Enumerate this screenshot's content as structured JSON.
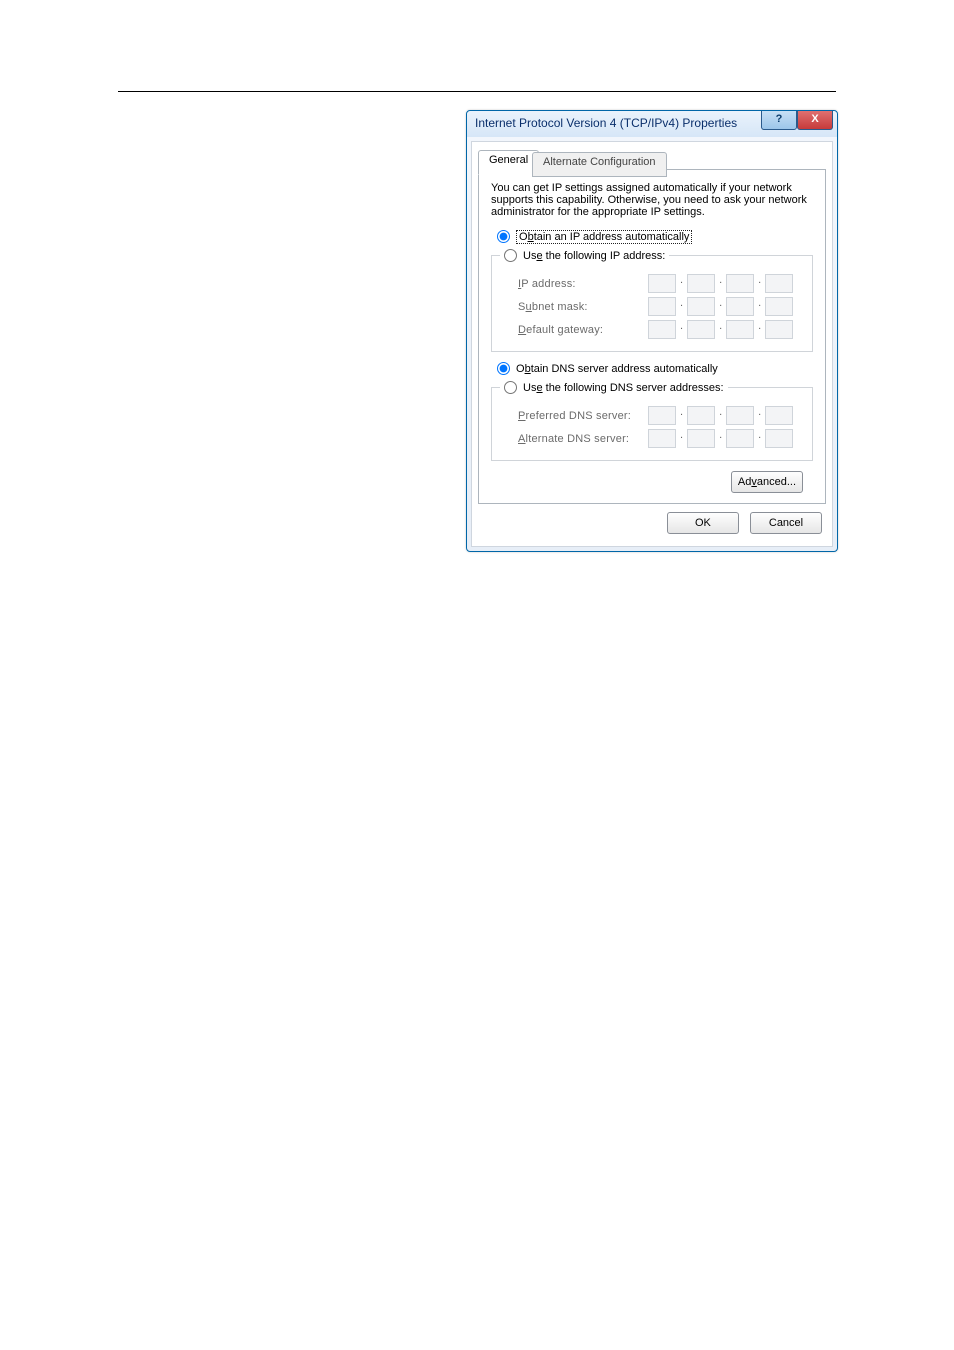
{
  "dialog": {
    "title": "Internet Protocol Version 4 (TCP/IPv4) Properties",
    "helpGlyph": "?",
    "closeGlyph": "X",
    "tabs": {
      "general": "General",
      "alt": "Alternate Configuration"
    },
    "desc": "You can get IP settings assigned automatically if your network supports this capability. Otherwise, you need to ask your network administrator for the appropriate IP settings.",
    "radio": {
      "ip_auto_pre": "O",
      "ip_auto_u": "b",
      "ip_auto_post": "tain an IP address automatically",
      "ip_use_pre": "Us",
      "ip_use_u": "e",
      "ip_use_post": " the following IP address:",
      "dns_auto_pre": "O",
      "dns_auto_u": "b",
      "dns_auto_post": "tain DNS server address automatically",
      "dns_use_pre": "Us",
      "dns_use_u": "e",
      "dns_use_post": " the following DNS server addresses:"
    },
    "labels": {
      "ip_pre": "",
      "ip_u": "I",
      "ip_post": "P address:",
      "subnet_pre": "S",
      "subnet_u": "u",
      "subnet_post": "bnet mask:",
      "gw_pre": "",
      "gw_u": "D",
      "gw_post": "efault gateway:",
      "pref_pre": "",
      "pref_u": "P",
      "pref_post": "referred DNS server:",
      "alt_pre": "",
      "alt_u": "A",
      "alt_post": "lternate DNS server:"
    },
    "buttons": {
      "adv_pre": "Ad",
      "adv_u": "v",
      "adv_post": "anced...",
      "ok": "OK",
      "cancel": "Cancel"
    }
  }
}
